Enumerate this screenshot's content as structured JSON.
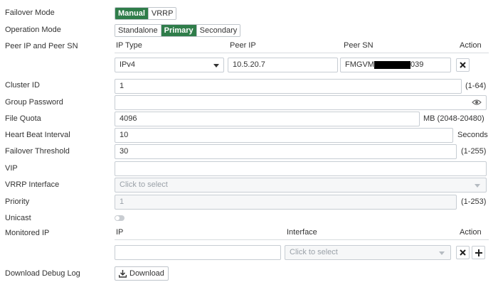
{
  "labels": {
    "failover_mode": "Failover Mode",
    "operation_mode": "Operation Mode",
    "peer": "Peer IP and Peer SN",
    "cluster_id": "Cluster ID",
    "group_password": "Group Password",
    "file_quota": "File Quota",
    "heartbeat": "Heart Beat Interval",
    "failover_threshold": "Failover Threshold",
    "vip": "VIP",
    "vrrp_interface": "VRRP Interface",
    "priority": "Priority",
    "unicast": "Unicast",
    "monitored_ip": "Monitored IP",
    "download_debug_log": "Download Debug Log"
  },
  "failover_mode": {
    "options": [
      "Manual",
      "VRRP"
    ],
    "selected": "Manual"
  },
  "operation_mode": {
    "options": [
      "Standalone",
      "Primary",
      "Secondary"
    ],
    "selected": "Primary"
  },
  "peer_table": {
    "headers": {
      "ip_type": "IP Type",
      "peer_ip": "Peer IP",
      "peer_sn": "Peer SN",
      "action": "Action"
    },
    "row": {
      "ip_type": "IPv4",
      "peer_ip": "10.5.20.7",
      "peer_sn_prefix": "FMGVM",
      "peer_sn_suffix": "039"
    }
  },
  "fields": {
    "cluster_id": {
      "value": "1",
      "range": "(1-64)"
    },
    "group_password": {
      "value": ""
    },
    "file_quota": {
      "value": "4096",
      "range": "MB (2048-20480)"
    },
    "heartbeat": {
      "value": "10",
      "unit": "Seconds"
    },
    "failover_threshold": {
      "value": "30",
      "range": "(1-255)"
    },
    "vip": {
      "value": ""
    },
    "vrrp_interface": {
      "placeholder": "Click to select"
    },
    "priority": {
      "value": "1",
      "range": "(1-253)"
    },
    "unicast": {
      "enabled": false
    }
  },
  "monitored_table": {
    "headers": {
      "ip": "IP",
      "interface": "Interface",
      "action": "Action"
    },
    "interface_placeholder": "Click to select"
  },
  "download_button": "Download",
  "colors": {
    "accent": "#2f7d4a",
    "border": "#c7cdd3"
  }
}
